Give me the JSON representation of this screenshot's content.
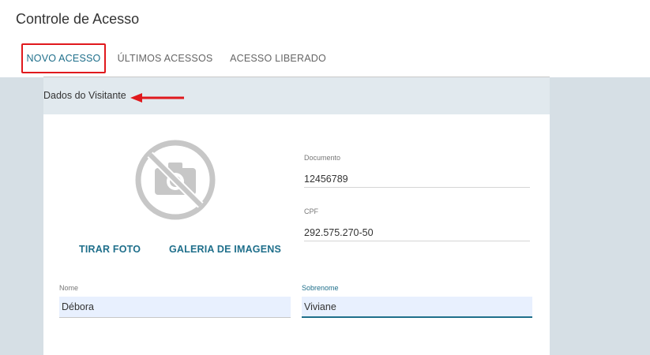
{
  "page": {
    "title": "Controle de Acesso"
  },
  "tabs": [
    {
      "label": "NOVO ACESSO",
      "active": true
    },
    {
      "label": "ÚLTIMOS ACESSOS",
      "active": false
    },
    {
      "label": "ACESSO LIBERADO",
      "active": false
    }
  ],
  "section": {
    "title": "Dados do Visitante"
  },
  "photo": {
    "icon": "no-camera-icon",
    "take_photo_label": "TIRAR FOTO",
    "gallery_label": "GALERIA DE IMAGENS"
  },
  "form": {
    "documento": {
      "label": "Documento",
      "value": "12456789"
    },
    "cpf": {
      "label": "CPF",
      "value": "292.575.270-50"
    },
    "nome": {
      "label": "Nome",
      "value": "Débora"
    },
    "sobrenome": {
      "label": "Sobrenome",
      "value": "Viviane"
    }
  },
  "colors": {
    "accent": "#1f6f8b",
    "highlight_box": "#e0191d",
    "annotation_arrow": "#e0191d",
    "background_area": "#d6dfe5",
    "autofill_field": "#e8f0fe"
  }
}
